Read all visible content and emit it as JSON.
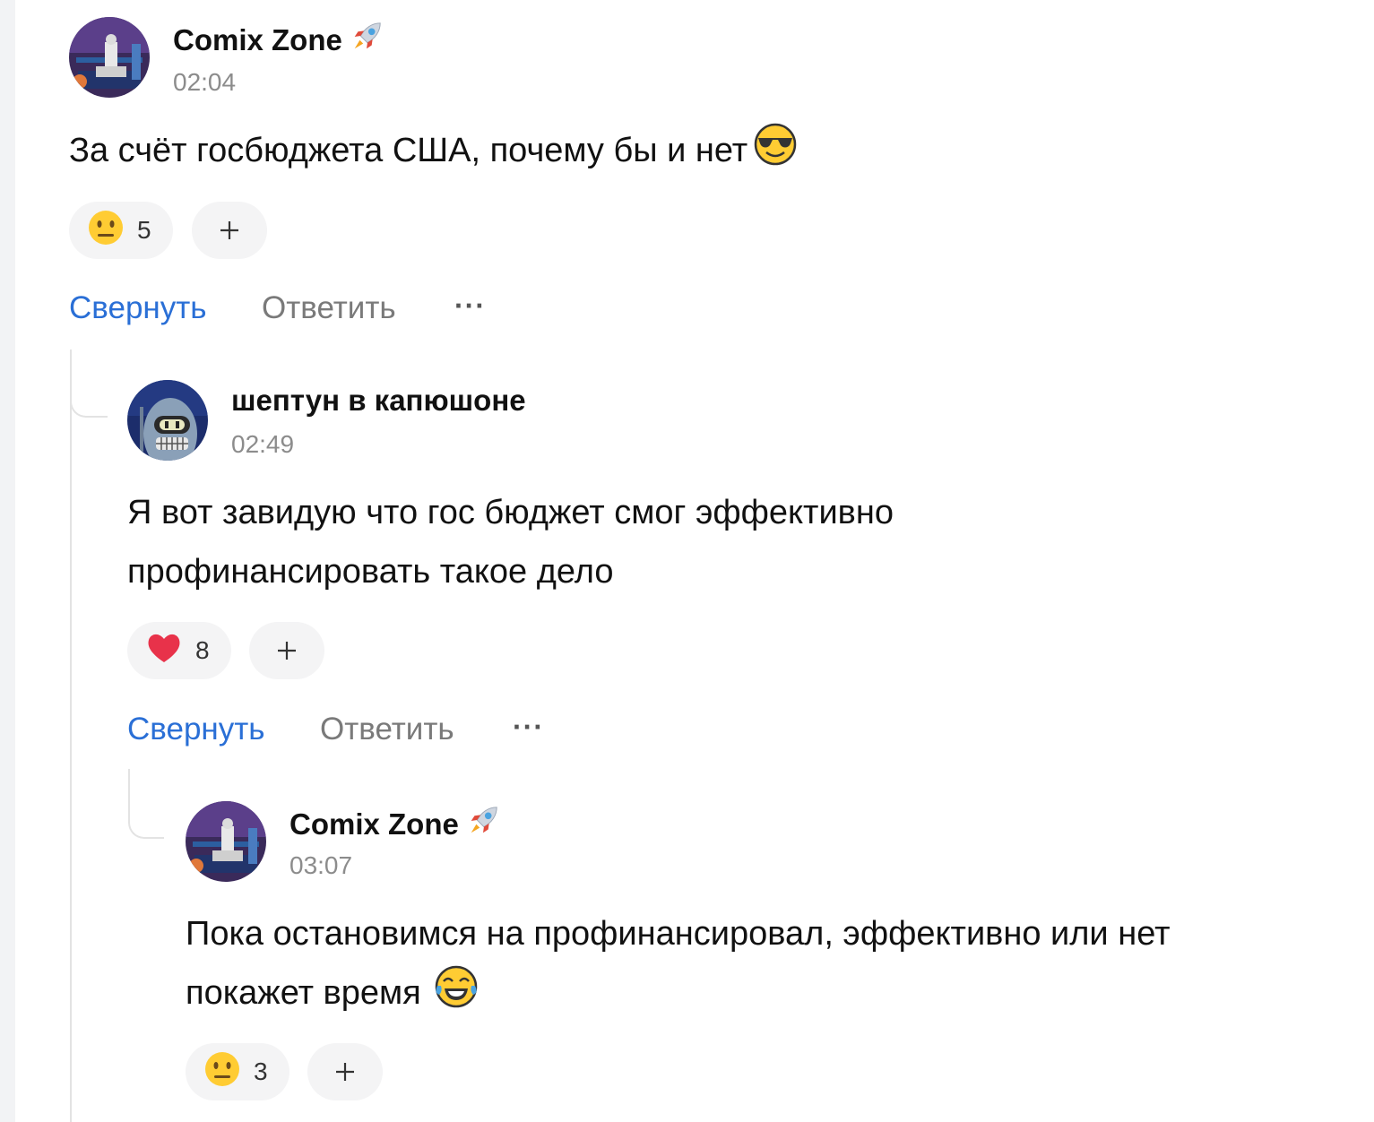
{
  "comments": [
    {
      "author": "Comix Zone",
      "author_badge": "rocket-icon",
      "time": "02:04",
      "text": "За счёт госбюджета США, почему бы и нет",
      "text_emoji": "smiling-face-with-sunglasses",
      "reaction": {
        "emoji": "neutral-face",
        "count": "5"
      },
      "collapse_label": "Свернуть",
      "reply_label": "Ответить",
      "more_label": "···"
    },
    {
      "author": "шептун в капюшоне",
      "time": "02:49",
      "text_line1": "Я вот завидую что гос бюджет смог эффективно",
      "text_line2": "профинансировать такое дело",
      "reaction": {
        "emoji": "red-heart",
        "count": "8"
      },
      "collapse_label": "Свернуть",
      "reply_label": "Ответить",
      "more_label": "···"
    },
    {
      "author": "Comix Zone",
      "author_badge": "rocket-icon",
      "time": "03:07",
      "text_line1": "Пока остановимся на профинансировал, эффективно или нет",
      "text_line2": "покажет время",
      "text_emoji": "face-with-tears-of-joy",
      "reaction": {
        "emoji": "neutral-face",
        "count": "3"
      }
    }
  ],
  "add_reaction_label": "+",
  "colors": {
    "link": "#2a6fd6",
    "muted": "#8c8c8c",
    "chip": "#f4f4f5"
  }
}
